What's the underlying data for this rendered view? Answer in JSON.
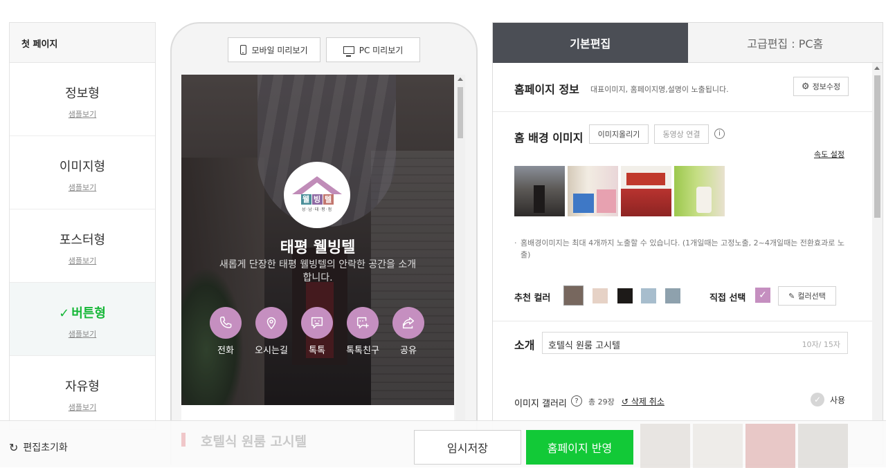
{
  "sidebar": {
    "title": "첫 페이지",
    "sample_label": "샘플보기",
    "templates": [
      {
        "name": "정보형",
        "active": false
      },
      {
        "name": "이미지형",
        "active": false
      },
      {
        "name": "포스터형",
        "active": false
      },
      {
        "name": "버튼형",
        "active": true
      },
      {
        "name": "자유형",
        "active": false
      }
    ]
  },
  "preview": {
    "mobile_label": "모바일 미리보기",
    "pc_label": "PC 미리보기",
    "logo": {
      "letters": [
        "웰",
        "빙",
        "텔"
      ],
      "letter_colors": [
        "#4c8f9a",
        "#8f6aa3",
        "#c2766e"
      ],
      "sub": "성·남·태·평·점"
    },
    "site_title": "태평 웰빙텔",
    "site_desc": "새롭게 단장한 태평 웰빙텔의 안락한 공간을 소개합니다.",
    "actions": [
      {
        "label": "전화",
        "icon": "phone-icon"
      },
      {
        "label": "오시는길",
        "icon": "location-pin-icon"
      },
      {
        "label": "톡톡",
        "icon": "chat-icon"
      },
      {
        "label": "톡톡친구",
        "icon": "chat-plus-icon"
      },
      {
        "label": "공유",
        "icon": "share-icon"
      }
    ]
  },
  "editor": {
    "tabs": [
      "기본편집",
      "고급편집 : PC홈"
    ],
    "active_tab": "기본편집",
    "home_info": {
      "title": "홈페이지 정보",
      "note": "대표이미지, 홈페이지명,설명이 노출됩니다.",
      "button": "정보수정"
    },
    "background": {
      "title": "홈 배경 이미지",
      "upload_button": "이미지올리기",
      "video_button": "동영상 연결",
      "speed_link": "속도 설정",
      "note": "홈배경이미지는 최대 4개까지 노출할 수 있습니다. (1개일때는 고정노출, 2~4개일때는 전환효과로 노출)"
    },
    "colors": {
      "label": "추천 컬러",
      "swatches": [
        "#77675e",
        "#e6d2c6",
        "#1d1a18",
        "#a7bdcd",
        "#8ea1ad"
      ],
      "direct_label": "직접 선택",
      "direct_color": "#c58fc0",
      "picker_button": "컬러선택"
    },
    "intro": {
      "label": "소개",
      "value": "호텔식 원룸 고시텔",
      "counter": "10자/ 15자"
    },
    "gallery": {
      "title": "이미지 갤러리",
      "count": "총 29장",
      "undo": "삭제 취소",
      "use_label": "사용"
    }
  },
  "bottom": {
    "reset_label": "편집초기화",
    "ghost_title": "호텔식 원룸 고시텔",
    "save_temp": "임시저장",
    "publish": "홈페이지 반영"
  }
}
